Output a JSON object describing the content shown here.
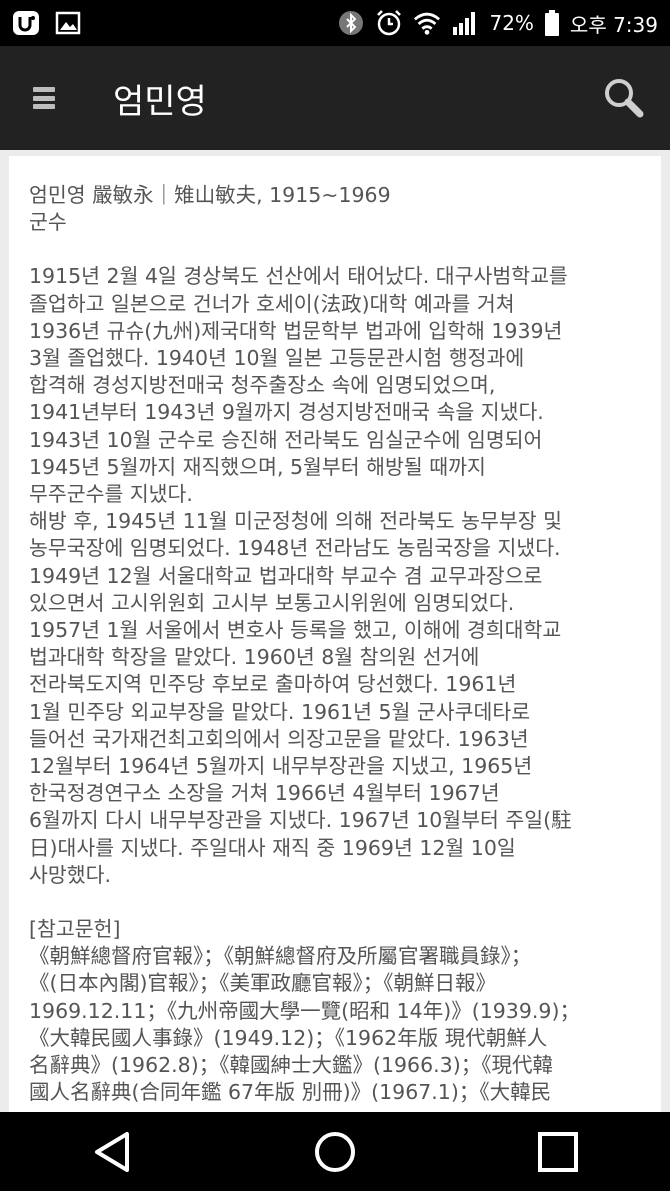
{
  "status_bar": {
    "battery": "72%",
    "time": "오후 7:39"
  },
  "app_bar": {
    "title": "엄민영"
  },
  "article": {
    "header_line1": "엄민영 嚴敏永｜雉山敏夫, 1915~1969",
    "header_line2": "군수",
    "body_lines": [
      "1915년 2월 4일 경상북도 선산에서 태어났다. 대구사범학교를",
      "졸업하고 일본으로 건너가 호세이(法政)대학 예과를 거쳐",
      "1936년 규슈(九州)제국대학 법문학부 법과에 입학해 1939년",
      "3월 졸업했다. 1940년 10월 일본 고등문관시험 행정과에",
      "합격해 경성지방전매국 청주출장소 속에 임명되었으며,",
      "1941년부터 1943년 9월까지 경성지방전매국 속을 지냈다.",
      "1943년 10월 군수로 승진해 전라북도 임실군수에 임명되어",
      "1945년 5월까지 재직했으며, 5월부터 해방될 때까지",
      "무주군수를 지냈다.",
      "해방 후, 1945년 11월 미군정청에 의해 전라북도 농무부장 및",
      "농무국장에 임명되었다. 1948년 전라남도 농림국장을 지냈다.",
      "1949년 12월 서울대학교 법과대학 부교수 겸 교무과장으로",
      "있으면서 고시위원회 고시부 보통고시위원에 임명되었다.",
      "1957년 1월 서울에서 변호사 등록을 했고, 이해에 경희대학교",
      "법과대학 학장을 맡았다. 1960년 8월 참의원 선거에",
      "전라북도지역 민주당 후보로 출마하여 당선했다. 1961년",
      "1월 민주당 외교부장을 맡았다. 1961년 5월 군사쿠데타로",
      "들어선 국가재건최고회의에서 의장고문을 맡았다. 1963년",
      "12월부터 1964년 5월까지 내무부장관을 지냈고, 1965년",
      "한국정경연구소 소장을 거쳐 1966년 4월부터 1967년",
      "6월까지 다시 내무부장관을 지냈다. 1967년 10월부터 주일(駐",
      "日)대사를 지냈다. 주일대사 재직 중 1969년 12월 10일",
      "사망했다."
    ],
    "ref_title": "[참고문헌]",
    "ref_lines": [
      "《朝鮮總督府官報》；《朝鮮總督府及所屬官署職員錄》；",
      "《(日本內閣)官報》；《美軍政廳官報》；《朝鮮日報》",
      "1969.12.11；《九州帝國大學一覽(昭和 14年)》(1939.9)；",
      "《大韓民國人事錄》(1949.12)；《1962年版 現代朝鮮人",
      "名辭典》(1962.8)；《韓國紳士大鑑》(1966.3)；《現代韓",
      "國人名辭典(合同年鑑 67年版 別冊)》(1967.1)；《大韓民"
    ]
  }
}
